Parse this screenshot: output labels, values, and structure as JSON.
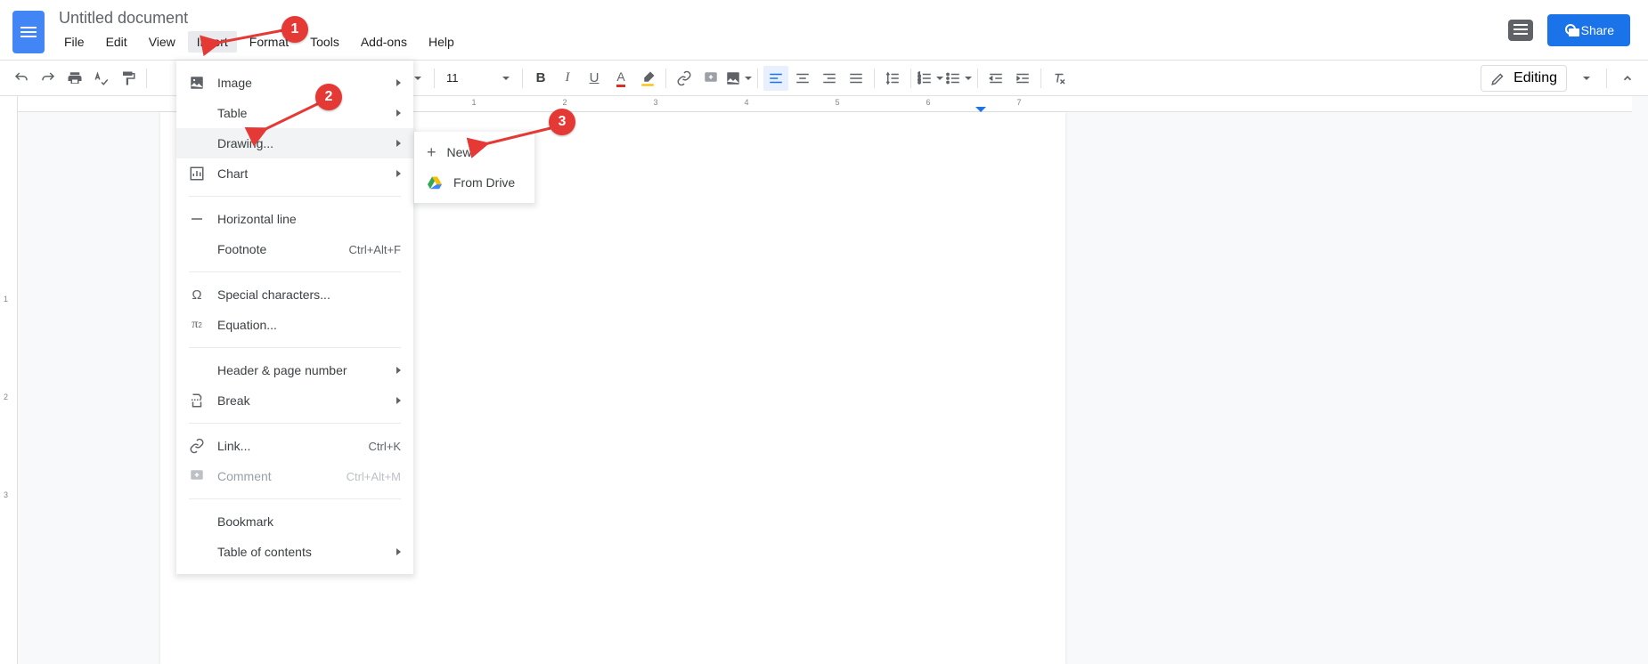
{
  "header": {
    "doc_title": "Untitled document",
    "menus": [
      "File",
      "Edit",
      "View",
      "Insert",
      "Format",
      "Tools",
      "Add-ons",
      "Help"
    ],
    "active_menu_index": 3,
    "share_label": "Share"
  },
  "toolbar": {
    "font_size": "11",
    "editing_label": "Editing"
  },
  "insert_menu": {
    "items": [
      {
        "label": "Image",
        "has_sub": true,
        "icon": "image"
      },
      {
        "label": "Table",
        "has_sub": true,
        "icon": "blank"
      },
      {
        "label": "Drawing...",
        "has_sub": true,
        "hov": true,
        "icon": "blank"
      },
      {
        "label": "Chart",
        "has_sub": true,
        "icon": "chart"
      },
      {
        "sep": true
      },
      {
        "label": "Horizontal line",
        "icon": "hr"
      },
      {
        "label": "Footnote",
        "shortcut": "Ctrl+Alt+F",
        "icon": "blank"
      },
      {
        "sep": true
      },
      {
        "label": "Special characters...",
        "icon": "omega"
      },
      {
        "label": "Equation...",
        "icon": "pi"
      },
      {
        "sep": true
      },
      {
        "label": "Header & page number",
        "has_sub": true,
        "icon": "blank"
      },
      {
        "label": "Break",
        "has_sub": true,
        "icon": "break"
      },
      {
        "sep": true
      },
      {
        "label": "Link...",
        "shortcut": "Ctrl+K",
        "icon": "link"
      },
      {
        "label": "Comment",
        "shortcut": "Ctrl+Alt+M",
        "icon": "comment",
        "disabled": true
      },
      {
        "sep": true
      },
      {
        "label": "Bookmark",
        "icon": "blank"
      },
      {
        "label": "Table of contents",
        "has_sub": true,
        "icon": "blank"
      }
    ]
  },
  "drawing_submenu": {
    "items": [
      {
        "label": "New",
        "icon": "plus"
      },
      {
        "label": "From Drive",
        "icon": "drive"
      }
    ]
  },
  "ruler": {
    "h_numbers": [
      1,
      2,
      3,
      4,
      5,
      6,
      7
    ],
    "v_numbers": [
      1,
      2,
      3
    ]
  },
  "annotations": {
    "n1": "1",
    "n2": "2",
    "n3": "3"
  }
}
